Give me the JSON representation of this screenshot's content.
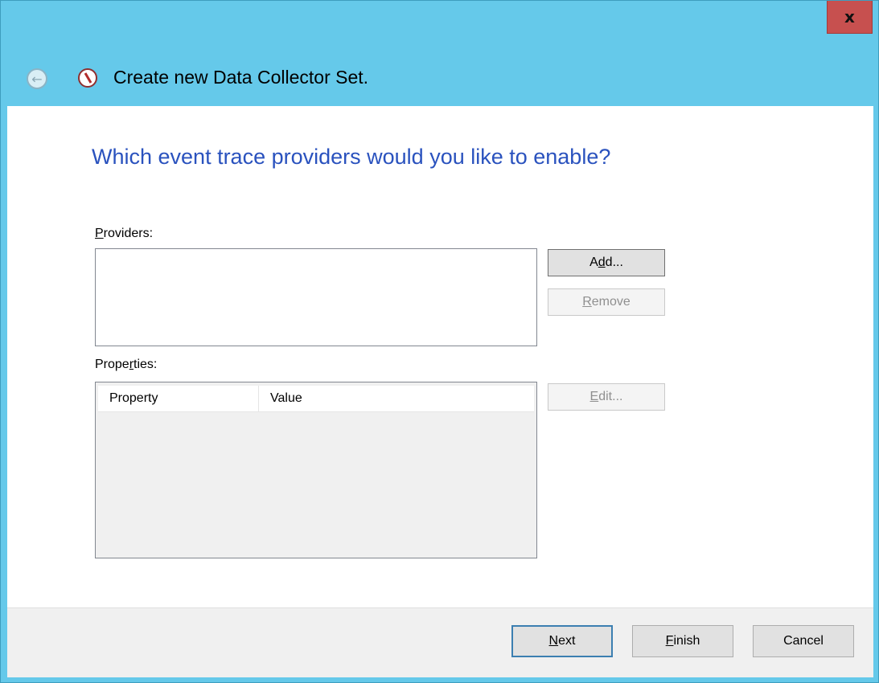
{
  "window": {
    "close_label": "x",
    "title": "Create new Data Collector Set.",
    "accent_color": "#65c9ea"
  },
  "nav": {
    "back_icon": "back-arrow-icon",
    "app_icon": "performance-monitor-icon"
  },
  "page": {
    "question": "Which event trace providers would you like to enable?"
  },
  "providers": {
    "label": "Providers:",
    "add_label": "Add...",
    "remove_label": "Remove"
  },
  "properties": {
    "label": "Properties:",
    "columns": [
      "Property",
      "Value"
    ],
    "edit_label": "Edit..."
  },
  "footer": {
    "next_label": "Next",
    "finish_label": "Finish",
    "cancel_label": "Cancel"
  }
}
